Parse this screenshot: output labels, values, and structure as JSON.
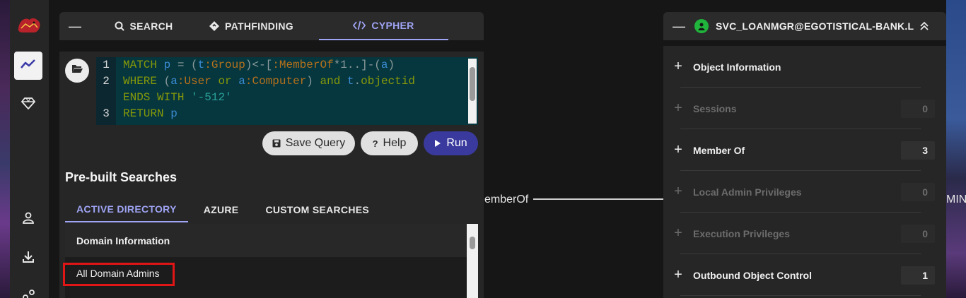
{
  "search_panel": {
    "tabs": [
      {
        "label": "SEARCH",
        "icon": "search-icon"
      },
      {
        "label": "PATHFINDING",
        "icon": "pathfinding-icon"
      },
      {
        "label": "CYPHER",
        "icon": "code-icon",
        "active": true
      }
    ],
    "editor": {
      "line_numbers": [
        "1",
        "2",
        "3"
      ],
      "query": "MATCH p = (t:Group)<-[:MemberOf*1..]-(a)\nWHERE (a:User or a:Computer) and t.objectid\nENDS WITH '-512'\nRETURN p"
    },
    "buttons": {
      "save": "Save Query",
      "help": "Help",
      "run": "Run"
    },
    "prebuilt": {
      "title": "Pre-built Searches",
      "tabs": [
        "ACTIVE DIRECTORY",
        "AZURE",
        "CUSTOM SEARCHES"
      ],
      "active_tab": "ACTIVE DIRECTORY",
      "section": "Domain Information",
      "items": [
        "All Domain Admins"
      ]
    }
  },
  "graph": {
    "edge_label": "emberOf",
    "right_label": "MIN"
  },
  "node_panel": {
    "name": "SVC_LOANMGR@EGOTISTICAL-BANK.L...",
    "sections": [
      {
        "label": "Object Information",
        "count": null,
        "enabled": true
      },
      {
        "label": "Sessions",
        "count": "0",
        "enabled": false
      },
      {
        "label": "Member Of",
        "count": "3",
        "enabled": true
      },
      {
        "label": "Local Admin Privileges",
        "count": "0",
        "enabled": false
      },
      {
        "label": "Execution Privileges",
        "count": "0",
        "enabled": false
      },
      {
        "label": "Outbound Object Control",
        "count": "1",
        "enabled": true
      }
    ]
  },
  "colors": {
    "accent": "#9fa4f4",
    "run_button": "#3a3a9e",
    "highlight_box": "#e01515",
    "user_node": "#20b43c"
  }
}
